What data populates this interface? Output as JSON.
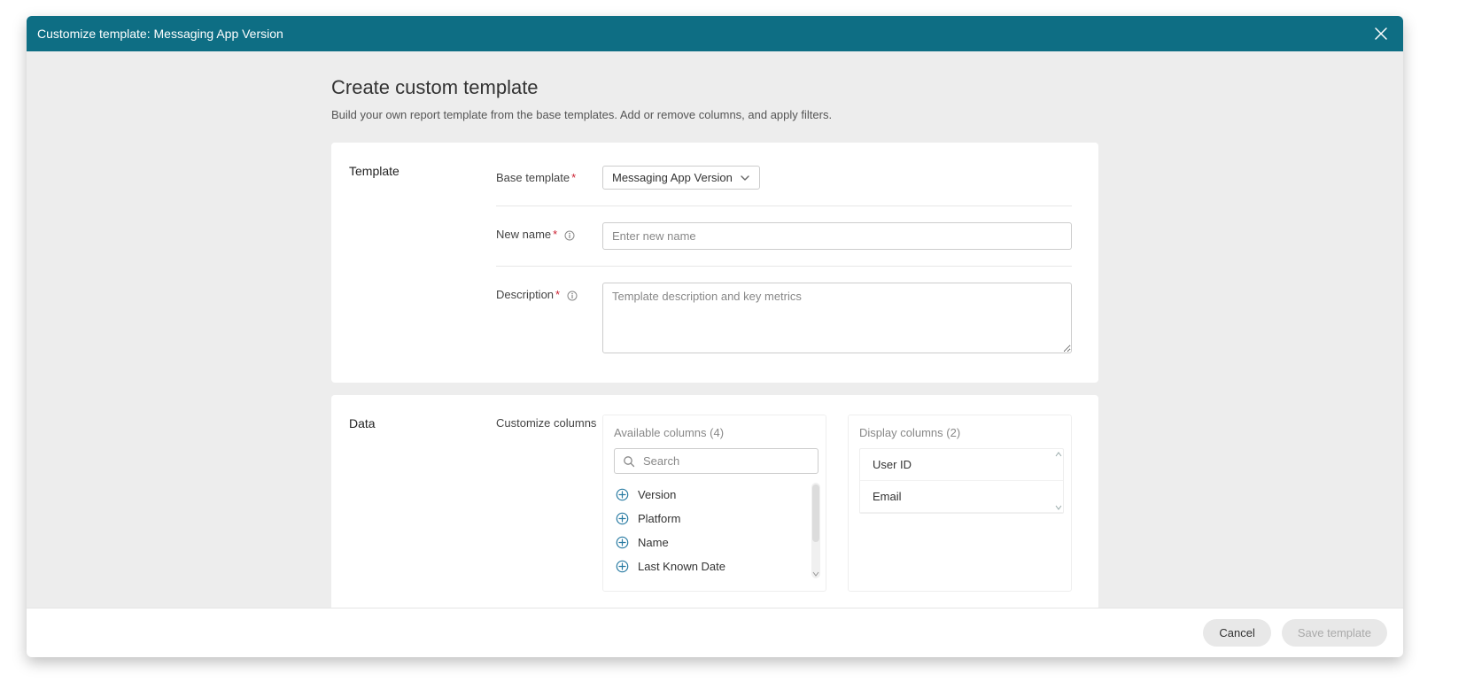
{
  "dialog": {
    "title": "Customize template: Messaging App Version"
  },
  "page": {
    "heading": "Create custom template",
    "subheading": "Build your own report template from the base templates. Add or remove columns, and apply filters."
  },
  "template_section": {
    "label": "Template",
    "base_template": {
      "label": "Base template",
      "value": "Messaging App Version"
    },
    "new_name": {
      "label": "New name",
      "placeholder": "Enter new name",
      "value": ""
    },
    "description": {
      "label": "Description",
      "placeholder": "Template description and key metrics",
      "value": ""
    }
  },
  "data_section": {
    "label": "Data",
    "columns_label": "Customize columns",
    "available": {
      "title": "Available columns (4)",
      "search_placeholder": "Search",
      "items": [
        "Version",
        "Platform",
        "Name",
        "Last Known Date"
      ]
    },
    "display": {
      "title": "Display columns (2)",
      "items": [
        "User ID",
        "Email"
      ]
    }
  },
  "footer": {
    "cancel": "Cancel",
    "save": "Save template"
  }
}
